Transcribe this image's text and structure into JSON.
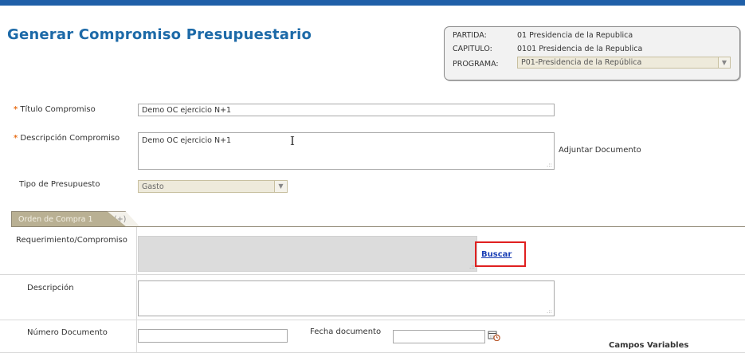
{
  "header": {
    "title": "Generar Compromiso Presupuestario"
  },
  "context": {
    "partida_label": "PARTIDA:",
    "partida_value": "01 Presidencia de la Republica",
    "capitulo_label": "CAPITULO:",
    "capitulo_value": "0101 Presidencia de la Republica",
    "programa_label": "PROGRAMA:",
    "programa_value": "P01-Presidencia de la República"
  },
  "form": {
    "required_mark": "*",
    "titulo_label": "Título Compromiso",
    "titulo_value": "Demo OC ejercicio N+1",
    "descripcion_label": "Descripción Compromiso",
    "descripcion_value": "Demo OC ejercicio N+1",
    "adjuntar_label": "Adjuntar Documento",
    "tipo_label": "Tipo de Presupuesto",
    "tipo_value": "Gasto"
  },
  "tabs": [
    {
      "label": "Orden de Compra 1",
      "active": true
    },
    {
      "label": "(+)",
      "active": false
    }
  ],
  "orden": {
    "requerimiento_label": "Requerimiento/Compromiso",
    "buscar_label": "Buscar",
    "descripcion_label": "Descripción",
    "numero_label": "Número Documento",
    "numero_value": "",
    "fecha_label": "Fecha documento",
    "fecha_value": "",
    "campos_label": "Campos Variables"
  },
  "icons": {
    "select_arrow": "chevron-down-icon",
    "calendar": "calendar-clock-icon",
    "cursor": "text-cursor-icon"
  },
  "colors": {
    "title": "#1d6aa8",
    "topbar": "#1f5fa8",
    "required": "#e8701a",
    "highlight": "#e02020",
    "tab_active": "#b9b093"
  }
}
